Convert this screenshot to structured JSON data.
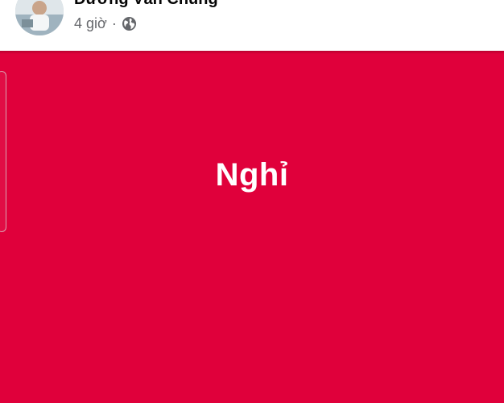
{
  "post": {
    "author_name": "Dương Văn Chung",
    "time_ago": "4 giờ",
    "separator": "·",
    "audience_icon": "globe-icon",
    "avatar_icon": "profile-photo"
  },
  "card": {
    "background_color": "#e0003b",
    "text_color": "#ffffff",
    "text": "Nghỉ"
  }
}
